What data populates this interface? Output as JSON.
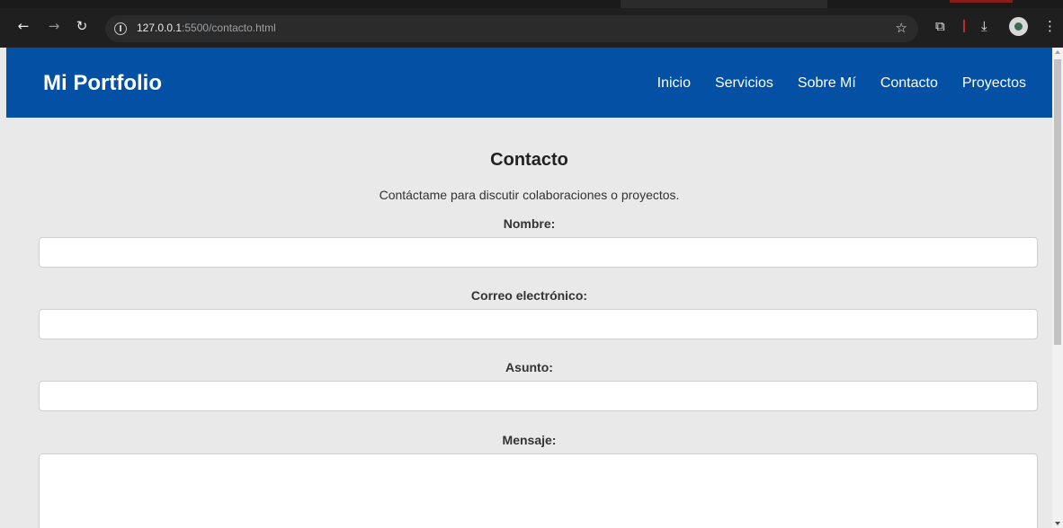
{
  "browser": {
    "url_host": "127.0.0.1",
    "url_rest": ":5500/contacto.html",
    "icons": [
      "back-arrow-icon",
      "forward-arrow-icon",
      "reload-icon",
      "info-icon",
      "star-icon",
      "extensions-icon",
      "download-icon",
      "profile-avatar",
      "menu-kebab-icon"
    ]
  },
  "header": {
    "brand": "Mi Portfolio",
    "nav": [
      "Inicio",
      "Servicios",
      "Sobre Mí",
      "Contacto",
      "Proyectos"
    ]
  },
  "contact": {
    "title": "Contacto",
    "intro": "Contáctame para discutir colaboraciones o proyectos.",
    "fields": {
      "name_label": "Nombre:",
      "email_label": "Correo electrónico:",
      "subject_label": "Asunto:",
      "message_label": "Mensaje:"
    }
  },
  "colors": {
    "header_bg": "#0350a4",
    "page_bg": "#e9e9e9",
    "chrome_bg": "#1f1f1f"
  }
}
